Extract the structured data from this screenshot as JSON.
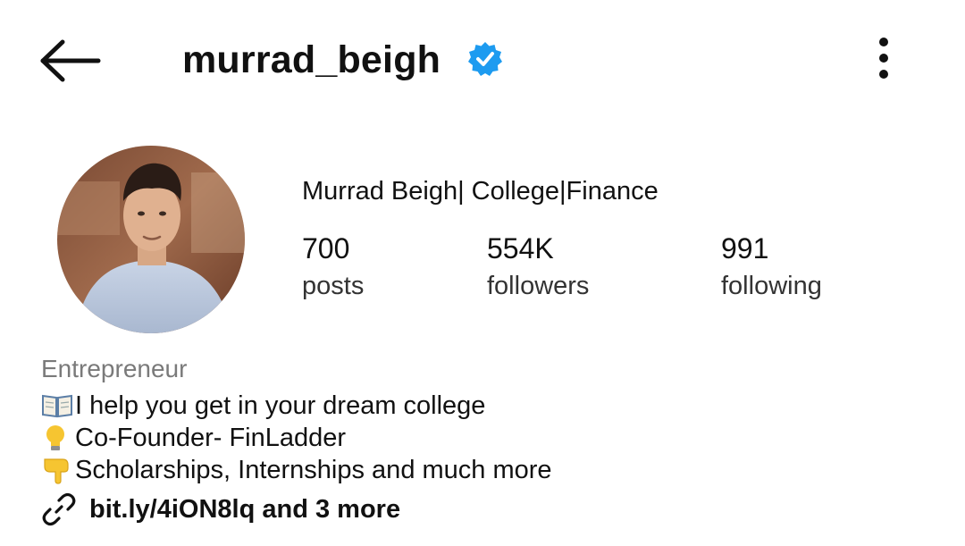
{
  "header": {
    "back_icon": "arrow-left-icon",
    "username": "murrad_beigh",
    "verified_icon": "verified-badge-icon",
    "verified_color": "#1D9BF0",
    "more_icon": "more-vertical-icon"
  },
  "profile": {
    "avatar_icon": "profile-photo",
    "display_name": "Murrad Beigh| College|Finance",
    "stats": {
      "posts": {
        "value": "700",
        "label": "posts"
      },
      "followers": {
        "value": "554K",
        "label": "followers"
      },
      "following": {
        "value": "991",
        "label": "following"
      }
    }
  },
  "bio": {
    "category": "Entrepreneur",
    "lines": [
      {
        "emoji": "book-icon",
        "text": "I help you get in your dream college"
      },
      {
        "emoji": "lightbulb-icon",
        "text": "Co-Founder- FinLadder"
      },
      {
        "emoji": "pointing-down-icon",
        "text": " Scholarships, Internships and much more"
      }
    ],
    "link_icon": "link-icon",
    "link_text": "bit.ly/4iON8lq and 3 more"
  }
}
